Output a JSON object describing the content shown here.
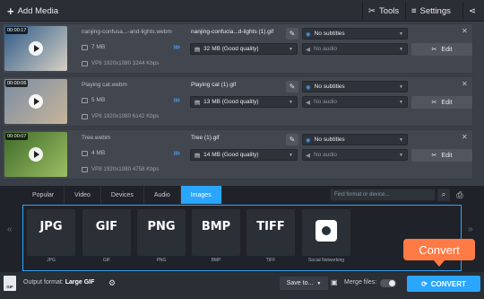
{
  "toolbar": {
    "add_media": "Add Media",
    "tools": "Tools",
    "settings": "Settings"
  },
  "files": [
    {
      "thumb_colors": [
        "#2f5b88",
        "#d6d0c4"
      ],
      "duration": "00:00:17",
      "source_name": "nanjing-confusa...-and-lights.webm",
      "source_size": "7 MB",
      "source_meta": "VP8 1920x1080 3244 Kbps",
      "output_name": "nanjing-confucia...d-lights (1).gif",
      "quality": "32 MB (Good quality)",
      "subtitles": "No subtitles",
      "audio": "No audio",
      "edit": "Edit"
    },
    {
      "thumb_colors": [
        "#7a8da3",
        "#c7b49a"
      ],
      "duration": "00:00:06",
      "source_name": "Playing cat.webm",
      "source_size": "5 MB",
      "source_meta": "VP8 1920x1080 6142 Kbps",
      "output_name": "Playing cat (1).gif",
      "quality": "13 MB (Good quality)",
      "subtitles": "No subtitles",
      "audio": "No audio",
      "edit": "Edit"
    },
    {
      "thumb_colors": [
        "#3e6b2a",
        "#9cbf64"
      ],
      "duration": "00:00:07",
      "source_name": "Tree.webm",
      "source_size": "4 MB",
      "source_meta": "VP8 1920x1080 4758 Kbps",
      "output_name": "Tree (1).gif",
      "quality": "14 MB (Good quality)",
      "subtitles": "No subtitles",
      "audio": "No audio",
      "edit": "Edit"
    }
  ],
  "tabs": [
    "Popular",
    "Video",
    "Devices",
    "Audio",
    "Images"
  ],
  "active_tab": "Images",
  "search_placeholder": "Find format or device...",
  "formats": [
    {
      "logo": "JPG",
      "caption": "JPG"
    },
    {
      "logo": "GIF",
      "caption": "GIF"
    },
    {
      "logo": "PNG",
      "caption": "PNG"
    },
    {
      "logo": "BMP",
      "caption": "BMP"
    },
    {
      "logo": "TIFF",
      "caption": "TIFF"
    },
    {
      "logo": "",
      "caption": "Social Networking"
    }
  ],
  "bottom": {
    "gif_icon": "GIF",
    "output_label": "Output format:",
    "output_value": "Large GIF",
    "save_to": "Save to...",
    "merge_label": "Merge files:",
    "convert": "CONVERT"
  },
  "callout": "Convert",
  "colors": {
    "accent": "#2aa6ff",
    "callout": "#ff7a45"
  }
}
